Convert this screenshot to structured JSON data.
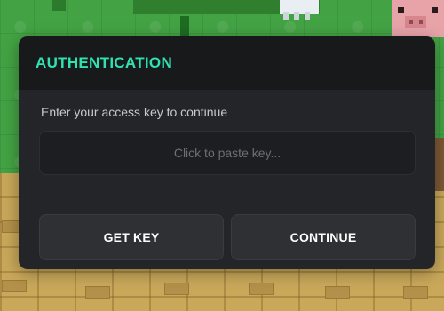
{
  "dialog": {
    "title": "AUTHENTICATION",
    "prompt": "Enter your access key to continue",
    "key_field": {
      "placeholder": "Click to paste key...",
      "value": ""
    },
    "buttons": {
      "get_key": "GET KEY",
      "continue": "CONTINUE"
    }
  },
  "colors": {
    "accent": "#2fe2b2",
    "panel": "#242528",
    "header": "#18191b",
    "button": "#2f3034"
  }
}
